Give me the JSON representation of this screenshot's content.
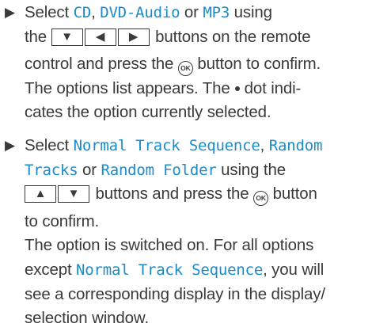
{
  "step1": {
    "bullet": "▶",
    "select": "Select",
    "opt_cd": "CD",
    "sep_comma": ",",
    "opt_dvd": "DVD-Audio",
    "or": "or",
    "opt_mp3": "MP3",
    "using": "using",
    "the": "the",
    "btn_down": "▼",
    "btn_left": "◀",
    "btn_right": "▶",
    "text_remote": "buttons on the remote",
    "text_control": "control and press the",
    "ok": "OK",
    "text_confirm": "button to confirm.",
    "text_list": "The options list appears. The",
    "text_dot": "dot indi-",
    "text_cates": "cates the option currently selected."
  },
  "step2": {
    "bullet": "▶",
    "select": "Select",
    "opt_normal": "Normal Track Sequence",
    "sep_comma": ",",
    "opt_random": "Random Tracks",
    "or": "or",
    "opt_folder": "Random Folder",
    "using": "using the",
    "btn_up": "▲",
    "btn_down": "▼",
    "text_press": "buttons and press the",
    "ok": "OK",
    "text_button": "button",
    "text_confirm": "to confirm.",
    "text_switched": "The option is switched on. For all options",
    "text_except": "except",
    "text_you_will": ", you will",
    "text_see": "see a corresponding display in the display/",
    "text_window": "selection window."
  },
  "colors": {
    "text": "#3a3a3a",
    "keyword": "#1a8cc9"
  }
}
